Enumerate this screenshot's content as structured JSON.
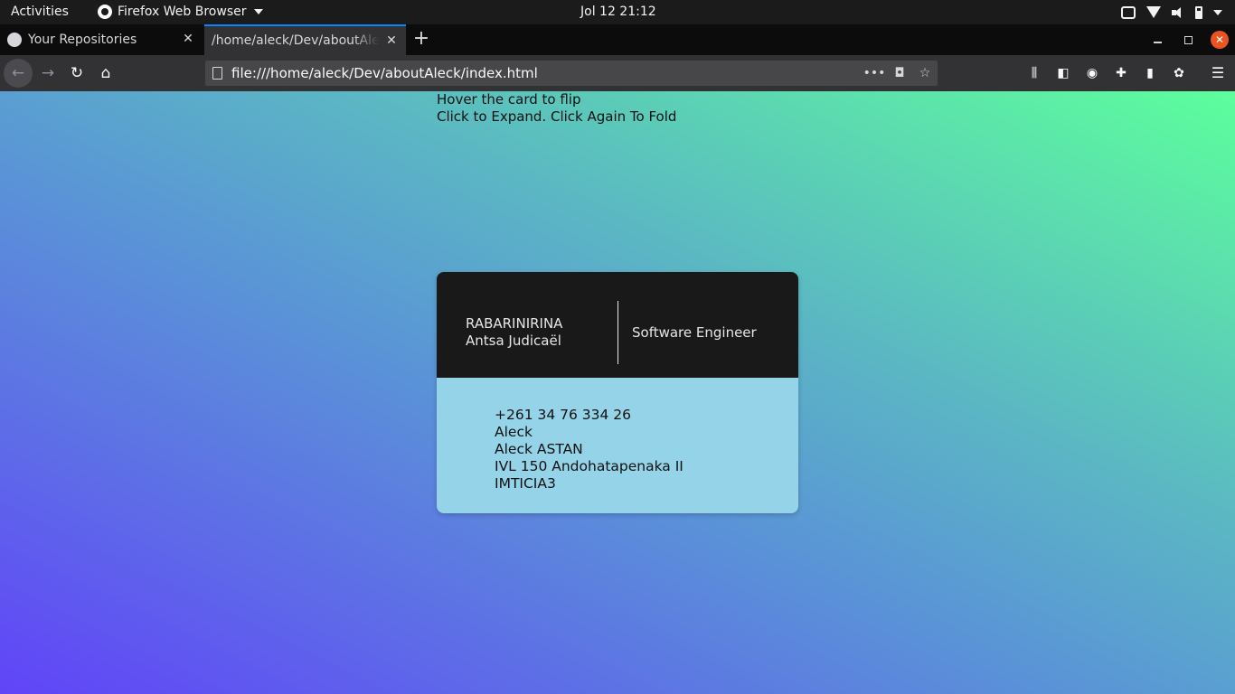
{
  "system_bar": {
    "activities": "Activities",
    "app_name": "Firefox Web Browser",
    "clock": "Jol 12  21:12"
  },
  "browser": {
    "tabs": [
      {
        "label": "Your Repositories",
        "icon": "github-icon",
        "active": false
      },
      {
        "label": "/home/aleck/Dev/aboutAleck",
        "icon": "none",
        "active": true
      }
    ],
    "new_tab_label": "+",
    "url": "file:///home/aleck/Dev/aboutAleck/index.html",
    "accent_color": "#0a84ff",
    "close_color": "#e95420"
  },
  "page": {
    "instructions": [
      "Hover the card to flip",
      "Click to Expand. Click Again To Fold"
    ],
    "card": {
      "name_line1": "RABARINIRINA",
      "name_line2": "Antsa Judicaël",
      "role": "Software Engineer",
      "details": [
        "+261 34 76 334 26",
        "Aleck",
        "Aleck ASTAN",
        "IVL 150 Andohatapenaka II",
        "IMTICIA3"
      ],
      "head_color": "#1a191a",
      "body_color": "#94d3e8"
    },
    "background_gradient": [
      "#6144f8",
      "#5a96d6",
      "#5bb9c2",
      "#5cff9c"
    ]
  }
}
